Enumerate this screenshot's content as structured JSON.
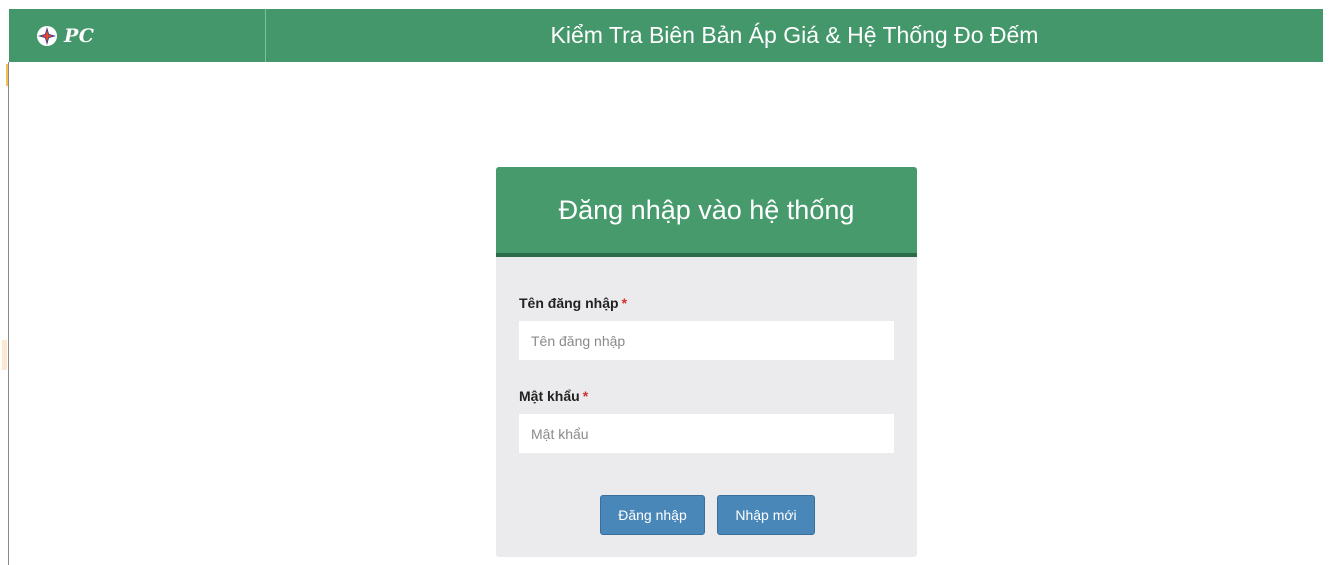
{
  "header": {
    "brand_text": "PC",
    "brand_icon": "evn-logo-icon",
    "title": "Kiểm Tra Biên Bản Áp Giá & Hệ Thống Đo Đếm",
    "color": "#43976b"
  },
  "login": {
    "title": "Đăng nhập vào hệ thống",
    "username": {
      "label": "Tên đăng nhập",
      "required_mark": "*",
      "placeholder": "Tên đăng nhập",
      "value": ""
    },
    "password": {
      "label": "Mật khẩu",
      "required_mark": "*",
      "placeholder": "Mật khẩu",
      "value": ""
    },
    "buttons": {
      "login_label": "Đăng nhập",
      "reset_label": "Nhập mới"
    },
    "colors": {
      "header": "#479a6c",
      "button": "#4a87b9",
      "required": "#d32f2f"
    }
  }
}
